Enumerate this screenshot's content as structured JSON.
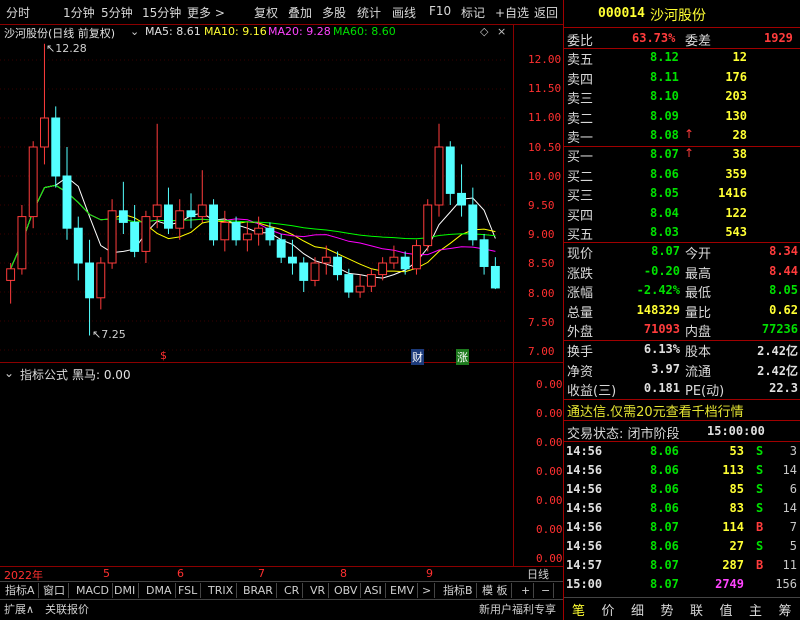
{
  "toolbar": {
    "left": [
      "分时",
      "1分钟",
      "5分钟",
      "15分钟",
      "更多 >"
    ],
    "right": [
      "复权",
      "叠加",
      "多股",
      "统计",
      "画线",
      "F10",
      "标记",
      "+自选",
      "返回"
    ]
  },
  "chart_header": {
    "title": "沙河股份(日线 前复权)",
    "ma5": "MA5: 8.61",
    "ma10": "MA10: 9.16",
    "ma20": "MA20: 9.28",
    "ma60": "MA60: 8.60",
    "high_note": "12.28",
    "low_note": "7.25"
  },
  "markers": {
    "s": "$",
    "cai": "财",
    "zhang": "涨"
  },
  "indicator": {
    "label": "指标公式",
    "value": "黑马: 0.00",
    "ticks": [
      "0.00",
      "0.00",
      "0.00",
      "0.00",
      "0.00",
      "0.00",
      "0.00"
    ]
  },
  "dates": {
    "year": "2022年",
    "m5": "5",
    "m6": "6",
    "m7": "7",
    "m8": "8",
    "m9": "9"
  },
  "bottom_tabs": [
    "指标A",
    "窗口",
    "MACD",
    "DMI",
    "DMA",
    "FSL",
    "TRIX",
    "BRAR",
    "CR",
    "VR",
    "OBV",
    "ASI",
    "EMV",
    ">",
    "指标B",
    "模 板",
    "+",
    "−",
    "日线"
  ],
  "bottom2": {
    "expand": "扩展∧",
    "link": "关联报价",
    "promo": "新用户福利专享"
  },
  "chart_data": {
    "type": "candlestick",
    "y_ticks": [
      "12.00",
      "11.50",
      "11.00",
      "10.50",
      "10.00",
      "9.50",
      "9.00",
      "8.50",
      "8.00",
      "7.50",
      "7.00"
    ],
    "ylim": [
      7.0,
      12.28
    ],
    "ma_colors": {
      "ma5": "#ffffff",
      "ma10": "#ffff00",
      "ma20": "#ff00ff",
      "ma60": "#00ff00"
    },
    "candles": [
      [
        8.2,
        8.5,
        7.8,
        8.4
      ],
      [
        8.4,
        9.5,
        8.3,
        9.3
      ],
      [
        9.3,
        10.6,
        9.1,
        10.5
      ],
      [
        10.5,
        12.28,
        10.2,
        11.0
      ],
      [
        11.0,
        11.2,
        9.8,
        10.0
      ],
      [
        10.0,
        10.5,
        8.9,
        9.1
      ],
      [
        9.1,
        9.3,
        8.2,
        8.5
      ],
      [
        8.5,
        8.9,
        7.25,
        7.9
      ],
      [
        7.9,
        8.6,
        7.7,
        8.5
      ],
      [
        8.5,
        9.6,
        8.4,
        9.4
      ],
      [
        9.4,
        9.9,
        9.0,
        9.2
      ],
      [
        9.2,
        9.5,
        8.6,
        8.7
      ],
      [
        8.7,
        9.4,
        8.5,
        9.3
      ],
      [
        9.3,
        10.9,
        9.1,
        9.5
      ],
      [
        9.5,
        9.8,
        9.0,
        9.1
      ],
      [
        9.1,
        9.6,
        8.9,
        9.4
      ],
      [
        9.4,
        9.7,
        9.1,
        9.3
      ],
      [
        9.3,
        10.1,
        9.2,
        9.5
      ],
      [
        9.5,
        9.6,
        8.8,
        8.9
      ],
      [
        8.9,
        9.4,
        8.7,
        9.2
      ],
      [
        9.2,
        9.3,
        8.8,
        8.9
      ],
      [
        8.9,
        9.2,
        8.7,
        9.0
      ],
      [
        9.0,
        9.3,
        8.8,
        9.1
      ],
      [
        9.1,
        9.2,
        8.8,
        8.9
      ],
      [
        8.9,
        9.0,
        8.5,
        8.6
      ],
      [
        8.6,
        8.9,
        8.3,
        8.5
      ],
      [
        8.5,
        8.6,
        8.0,
        8.2
      ],
      [
        8.2,
        8.6,
        8.1,
        8.5
      ],
      [
        8.5,
        8.8,
        8.3,
        8.6
      ],
      [
        8.6,
        8.7,
        8.2,
        8.3
      ],
      [
        8.3,
        8.4,
        7.9,
        8.0
      ],
      [
        8.0,
        8.3,
        7.9,
        8.1
      ],
      [
        8.1,
        8.4,
        8.0,
        8.3
      ],
      [
        8.3,
        8.6,
        8.2,
        8.5
      ],
      [
        8.5,
        8.8,
        8.4,
        8.6
      ],
      [
        8.6,
        8.7,
        8.3,
        8.4
      ],
      [
        8.4,
        8.9,
        8.3,
        8.8
      ],
      [
        8.8,
        9.6,
        8.7,
        9.5
      ],
      [
        9.5,
        10.9,
        9.3,
        10.5
      ],
      [
        10.5,
        10.6,
        9.5,
        9.7
      ],
      [
        9.7,
        10.2,
        9.3,
        9.5
      ],
      [
        9.5,
        9.8,
        8.8,
        8.9
      ],
      [
        8.9,
        9.0,
        8.3,
        8.44
      ],
      [
        8.44,
        8.6,
        8.05,
        8.07
      ]
    ]
  },
  "stock": {
    "code": "000014",
    "name": "沙河股份"
  },
  "wb": {
    "label1": "委比",
    "v1": "63.73%",
    "label2": "委差",
    "v2": "1929"
  },
  "asks": [
    {
      "label": "卖五",
      "price": "8.12",
      "vol": "12",
      "arrow": ""
    },
    {
      "label": "卖四",
      "price": "8.11",
      "vol": "176",
      "arrow": ""
    },
    {
      "label": "卖三",
      "price": "8.10",
      "vol": "203",
      "arrow": ""
    },
    {
      "label": "卖二",
      "price": "8.09",
      "vol": "130",
      "arrow": ""
    },
    {
      "label": "卖一",
      "price": "8.08",
      "vol": "28",
      "arrow": "↑"
    }
  ],
  "bids": [
    {
      "label": "买一",
      "price": "8.07",
      "vol": "38",
      "arrow": "↑"
    },
    {
      "label": "买二",
      "price": "8.06",
      "vol": "359",
      "arrow": ""
    },
    {
      "label": "买三",
      "price": "8.05",
      "vol": "1416",
      "arrow": ""
    },
    {
      "label": "买四",
      "price": "8.04",
      "vol": "122",
      "arrow": ""
    },
    {
      "label": "买五",
      "price": "8.03",
      "vol": "543",
      "arrow": ""
    }
  ],
  "quote": [
    {
      "l1": "现价",
      "v1": "8.07",
      "c1": "g",
      "l2": "今开",
      "v2": "8.34",
      "c2": "r"
    },
    {
      "l1": "涨跌",
      "v1": "-0.20",
      "c1": "g",
      "l2": "最高",
      "v2": "8.44",
      "c2": "r"
    },
    {
      "l1": "涨幅",
      "v1": "-2.42%",
      "c1": "g",
      "l2": "最低",
      "v2": "8.05",
      "c2": "g"
    },
    {
      "l1": "总量",
      "v1": "148329",
      "c1": "y",
      "l2": "量比",
      "v2": "0.62",
      "c2": "y"
    },
    {
      "l1": "外盘",
      "v1": "71093",
      "c1": "r",
      "l2": "内盘",
      "v2": "77236",
      "c2": "g"
    }
  ],
  "quote2": [
    {
      "l1": "换手",
      "v1": "6.13%",
      "l2": "股本",
      "v2": "2.42亿"
    },
    {
      "l1": "净资",
      "v1": "3.97",
      "l2": "流通",
      "v2": "2.42亿"
    },
    {
      "l1": "收益(三)",
      "v1": "0.181",
      "l2": "PE(动)",
      "v2": "22.3"
    }
  ],
  "promo_line": "通达信.仅需20元查看千档行情",
  "trade_status": {
    "label": "交易状态: 闭市阶段",
    "time": "15:00:00"
  },
  "ticks": [
    {
      "t": "14:56",
      "p": "8.06",
      "v": "53",
      "s": "S",
      "n": "3",
      "pc": "g",
      "vc": "y",
      "sc": "g"
    },
    {
      "t": "14:56",
      "p": "8.06",
      "v": "113",
      "s": "S",
      "n": "14",
      "pc": "g",
      "vc": "y",
      "sc": "g"
    },
    {
      "t": "14:56",
      "p": "8.06",
      "v": "85",
      "s": "S",
      "n": "6",
      "pc": "g",
      "vc": "y",
      "sc": "g"
    },
    {
      "t": "14:56",
      "p": "8.06",
      "v": "83",
      "s": "S",
      "n": "14",
      "pc": "g",
      "vc": "y",
      "sc": "g"
    },
    {
      "t": "14:56",
      "p": "8.07",
      "v": "114",
      "s": "B",
      "n": "7",
      "pc": "g",
      "vc": "y",
      "sc": "r"
    },
    {
      "t": "14:56",
      "p": "8.06",
      "v": "27",
      "s": "S",
      "n": "5",
      "pc": "g",
      "vc": "y",
      "sc": "g"
    },
    {
      "t": "14:57",
      "p": "8.07",
      "v": "287",
      "s": "B",
      "n": "11",
      "pc": "g",
      "vc": "y",
      "sc": "r"
    },
    {
      "t": "15:00",
      "p": "8.07",
      "v": "2749",
      "s": "",
      "n": "156",
      "pc": "g",
      "vc": "m",
      "sc": "g"
    }
  ],
  "footer_tabs": [
    "笔",
    "价",
    "细",
    "势",
    "联",
    "值",
    "主",
    "筹"
  ]
}
